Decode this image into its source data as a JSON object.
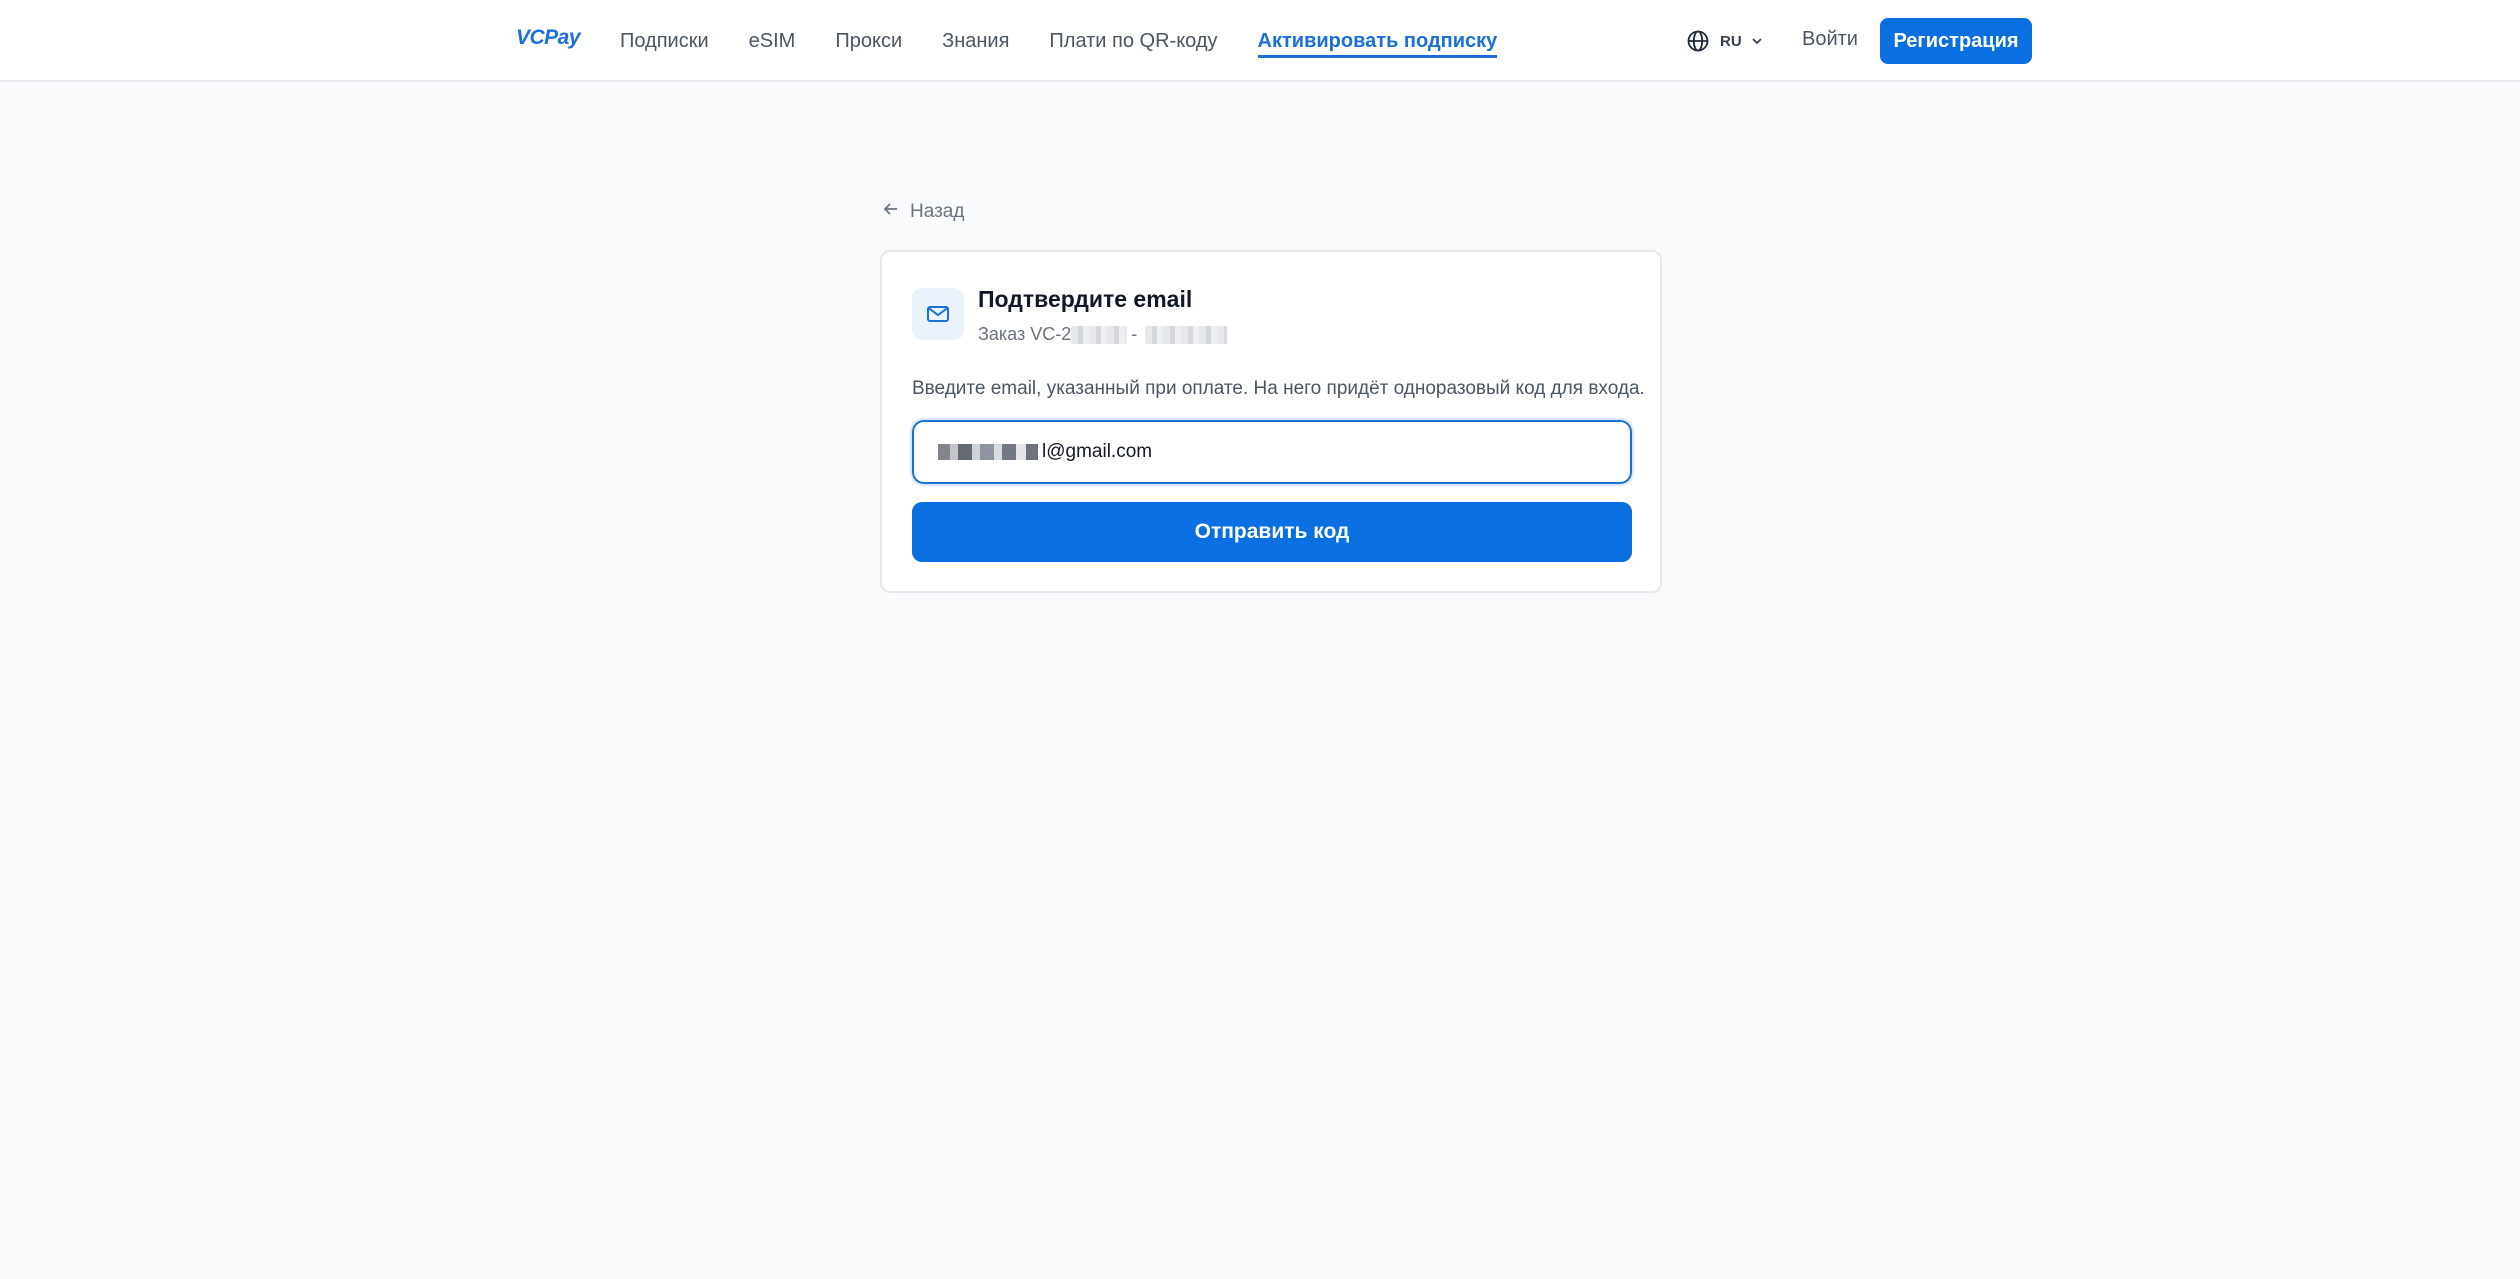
{
  "header": {
    "logo": "VCPay",
    "nav": [
      {
        "label": "Подписки"
      },
      {
        "label": "eSIM"
      },
      {
        "label": "Прокси"
      },
      {
        "label": "Знания"
      },
      {
        "label": "Плати по QR-коду"
      },
      {
        "label": "Активировать подписку",
        "active": true
      }
    ],
    "language": "RU",
    "login_label": "Войти",
    "register_label": "Регистрация"
  },
  "back_label": "Назад",
  "card": {
    "icon": "mail-icon",
    "title": "Подтвердите email",
    "order_prefix": "Заказ VC-2",
    "order_sep": "-",
    "description": "Введите email, указанный при оплате. На него придёт одноразовый код для входа.",
    "email_value": "l@gmail.com",
    "send_label": "Отправить код"
  },
  "colors": {
    "accent": "#0a6fe0",
    "background": "#f8fafc",
    "card": "#ffffff"
  }
}
